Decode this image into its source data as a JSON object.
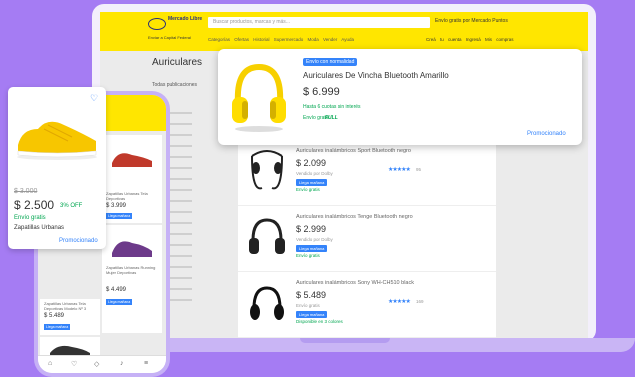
{
  "header": {
    "brand": "Mercado Libre",
    "search_placeholder": "Buscar productos, marcas y más...",
    "promo": "Envío gratis por Mercado Puntos",
    "location": "Enviar a Capital Federal",
    "nav": "Categorías Ofertas Historial Supermercado Moda Vender Ayuda",
    "account": "Creá tu cuenta Ingresá Mis compras"
  },
  "sidebar": {
    "title": "Auriculares",
    "subtitle": "Todas publicaciones"
  },
  "featured_card": {
    "badge": "Envío con normalidad",
    "title": "Auriculares De Vincha Bluetooth Amarillo",
    "price": "$ 6.999",
    "installments": "Hasta 6 cuotas sin interés",
    "shipping": "Envío gratis",
    "full": "FULL",
    "promo": "Promocionado"
  },
  "results": [
    {
      "title": "Auriculares inalámbricos Sport Bluetooth negro",
      "price": "$ 2.099",
      "sub": "Vendido por Dolby",
      "tag": "Llega mañana",
      "ship": "Envío gratis",
      "stars": "★★★★★",
      "count": "95"
    },
    {
      "title": "Auriculares inalámbricos Tenge Bluetooth negro",
      "price": "$ 2.999",
      "sub": "Vendido por Dolby",
      "tag": "Llega mañana",
      "ship": "Envío gratis",
      "stars": "",
      "count": ""
    },
    {
      "title": "Auriculares inalámbricos Sony WH-CH510 black",
      "price": "$ 5.489",
      "sub": "Envío gratis",
      "tag": "Llega mañana",
      "ship": "Disponible en 3 colores",
      "stars": "★★★★★",
      "count": "169"
    }
  ],
  "shoe_card": {
    "old_price": "$ 3.000",
    "price": "$ 2.500",
    "discount": "3% OFF",
    "shipping": "Envío gratis",
    "name": "Zapatillas Urbanas",
    "promo": "Promocionado"
  },
  "phone": {
    "cells": [
      {
        "title": "Zapatillas Urbanas Tela Deportivas",
        "price": "$ 3.999",
        "tag": "Llega mañana"
      },
      {
        "title": "Zapatilla Puma Running Deportiva",
        "price": "$ 2.690",
        "tag": "Llega mañana"
      },
      {
        "title": "Zapatillas Urbanas Tela Deportivas Modelo Nº 3",
        "price": "$ 5.489",
        "tag": "Llega mañana"
      },
      {
        "title": "Zapatillas Urbanas Running Mujer Deportivas",
        "price": "$ 4.499",
        "tag": "Llega mañana"
      }
    ]
  },
  "colors": {
    "yellow": "#ffe600",
    "blue": "#3483fa",
    "green": "#00a650",
    "background": "#a57cf3"
  }
}
